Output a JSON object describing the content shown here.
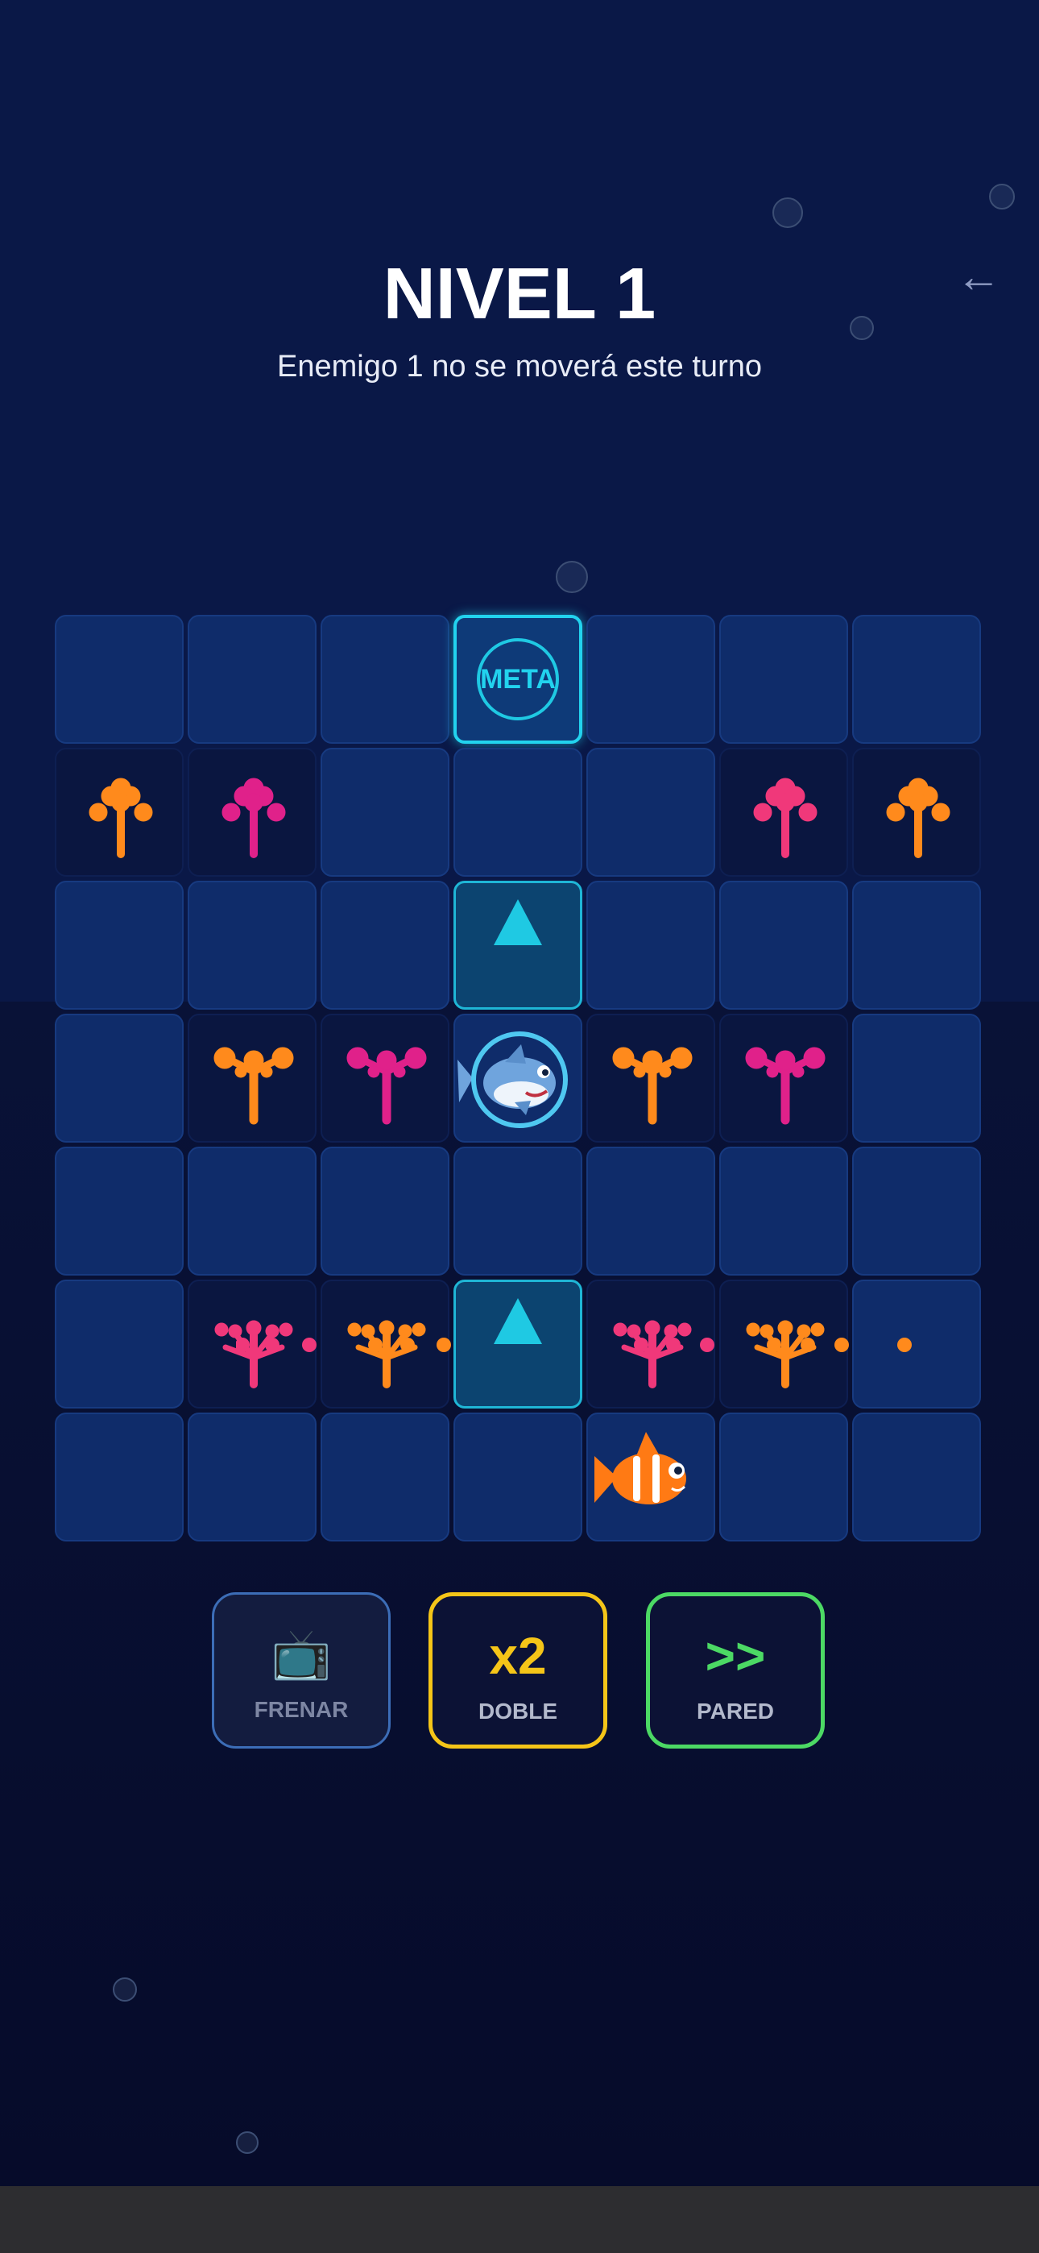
{
  "header": {
    "title": "NIVEL 1",
    "status_message": "Enemigo 1 no se moverá este turno",
    "back_icon": "left-arrow-icon"
  },
  "colors": {
    "background_top": "#0a1847",
    "background_bottom": "#080f31",
    "tile": "#0f2c6a",
    "goal_accent": "#22d3ee",
    "orange_anemone": "#ff8a1c",
    "magenta_anemone": "#e0218a",
    "pink_anemone": "#f0387a",
    "doble_accent": "#f5c518",
    "pared_accent": "#4cd964",
    "frenar_accent": "#3c6db7"
  },
  "board": {
    "rows": 7,
    "columns": 7,
    "goal_label": "META",
    "goal": {
      "row": 1,
      "col": 4
    },
    "path_arrows": [
      {
        "row": 3,
        "col": 4,
        "icon": "up-arrow-icon"
      },
      {
        "row": 6,
        "col": 4,
        "icon": "up-arrow-icon"
      }
    ],
    "shark": {
      "row": 4,
      "col": 4,
      "icon": "shark-icon"
    },
    "player_fish": {
      "row": 7,
      "col": 5,
      "icon": "clownfish-icon"
    },
    "anemones": [
      {
        "row": 2,
        "col": 1,
        "color": "orange",
        "shape": "tree"
      },
      {
        "row": 2,
        "col": 2,
        "color": "magenta",
        "shape": "tree"
      },
      {
        "row": 2,
        "col": 6,
        "color": "pink",
        "shape": "tree"
      },
      {
        "row": 2,
        "col": 7,
        "color": "orange",
        "shape": "tree"
      },
      {
        "row": 4,
        "col": 2,
        "color": "orange",
        "shape": "branch"
      },
      {
        "row": 4,
        "col": 3,
        "color": "magenta",
        "shape": "branch"
      },
      {
        "row": 4,
        "col": 5,
        "color": "orange",
        "shape": "branch"
      },
      {
        "row": 4,
        "col": 6,
        "color": "magenta",
        "shape": "branch"
      },
      {
        "row": 6,
        "col": 2,
        "color": "pink",
        "shape": "fan"
      },
      {
        "row": 6,
        "col": 3,
        "color": "orange",
        "shape": "fan"
      },
      {
        "row": 6,
        "col": 5,
        "color": "pink",
        "shape": "fan"
      },
      {
        "row": 6,
        "col": 6,
        "color": "orange",
        "shape": "fan"
      }
    ]
  },
  "powerups": {
    "frenar": {
      "icon": "tv-icon",
      "glyph": "📺",
      "label": "FRENAR",
      "enabled": false
    },
    "doble": {
      "glyph": "x2",
      "label": "DOBLE"
    },
    "pared": {
      "glyph": ">>",
      "label": "PARED"
    }
  }
}
